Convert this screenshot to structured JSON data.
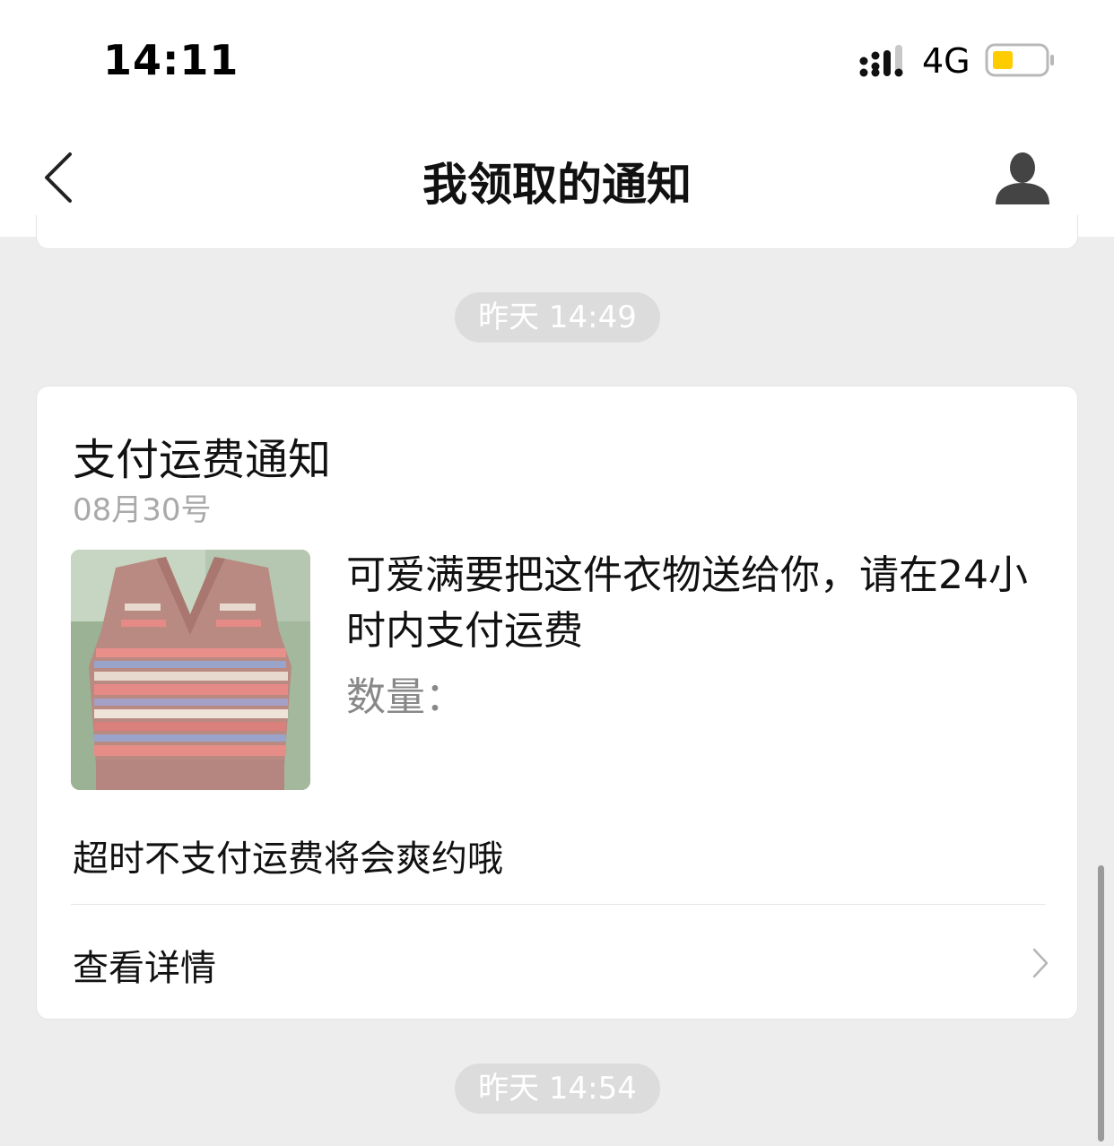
{
  "status_bar": {
    "time": "14:11",
    "network": "4G",
    "signal_icon": "cellular-signal-icon",
    "battery_icon": "battery-low-icon",
    "battery_color": "#ffcc00"
  },
  "nav": {
    "title": "我领取的通知",
    "back_icon": "back-chevron-icon",
    "profile_icon": "user-profile-icon"
  },
  "timestamps": {
    "first": "昨天 14:49",
    "second": "昨天 14:54"
  },
  "notification": {
    "title": "支付运费通知",
    "date": "08月30号",
    "message": "可爱满要把这件衣物送给你，请在24小时内支付运费",
    "quantity_label": "数量：",
    "note": "超时不支付运费将会爽约哦",
    "details_label": "查看详情",
    "image_icon": "knit-vest-photo",
    "chevron_icon": "chevron-right-icon"
  }
}
